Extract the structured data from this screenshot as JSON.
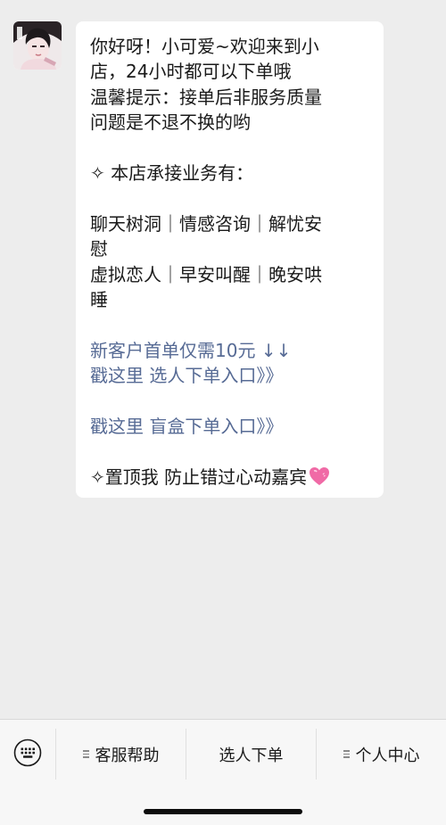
{
  "message": {
    "lines": [
      "你好呀！小可爱~欢迎来到小",
      "店，24小时都可以下单哦",
      "温馨提示：接单后非服务质量",
      "问题是不退不换的哟",
      "✧ 本店承接业务有：",
      "聊天树洞｜情感咨询｜解忧安",
      "慰",
      "虚拟恋人｜早安叫醒｜晚安哄",
      "睡",
      "新客户首单仅需10元 ↓↓",
      "戳这里 选人下单入口》》",
      "戳这里 盲盒下单入口》》",
      "✧置顶我 防止错过心动嘉宾"
    ],
    "heart_icon": "pink-heart-emoji",
    "link_color": "#576b95"
  },
  "menu": {
    "items": [
      {
        "label": "客服帮助"
      },
      {
        "label": "选人下单"
      },
      {
        "label": "个人中心"
      }
    ],
    "keyboard_icon": "keyboard-icon"
  }
}
